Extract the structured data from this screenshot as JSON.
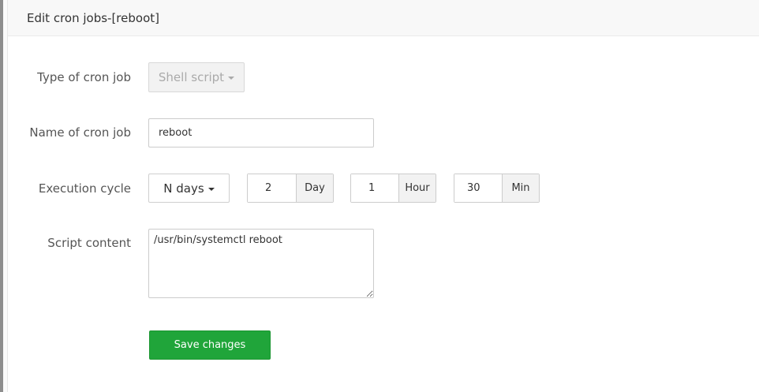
{
  "dialog": {
    "title": "Edit cron jobs-[reboot]"
  },
  "form": {
    "type": {
      "label": "Type of cron job",
      "value": "Shell script"
    },
    "name": {
      "label": "Name of cron job",
      "value": "reboot"
    },
    "cycle": {
      "label": "Execution cycle",
      "period": "N days",
      "days": "2",
      "days_unit": "Day",
      "hour": "1",
      "hour_unit": "Hour",
      "minute": "30",
      "minute_unit": "Min"
    },
    "script": {
      "label": "Script content",
      "value": "/usr/bin/systemctl reboot"
    },
    "save_label": "Save changes"
  },
  "colors": {
    "save_button": "#20a53a",
    "header_bg": "#f8f8f8"
  }
}
